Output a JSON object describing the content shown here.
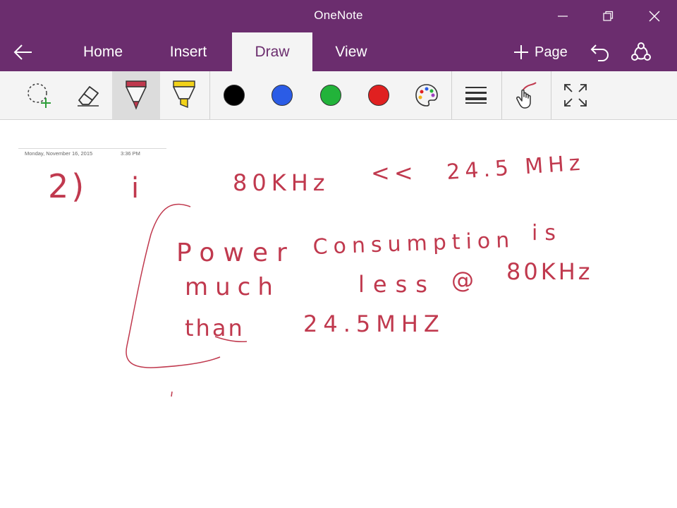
{
  "window": {
    "title": "OneNote",
    "controls": [
      "minimize",
      "restore",
      "close"
    ]
  },
  "ribbon": {
    "back_icon": "back-arrow-icon",
    "tabs": [
      {
        "label": "Home"
      },
      {
        "label": "Insert"
      },
      {
        "label": "Draw",
        "active": true
      },
      {
        "label": "View"
      }
    ],
    "add_page_label": "Page",
    "undo_icon": "undo-icon",
    "share_icon": "share-icon"
  },
  "toolbar": {
    "tools": [
      "lasso-select-icon",
      "eraser-icon",
      "pen-icon",
      "highlighter-icon"
    ],
    "selected_tool": "pen",
    "colors": [
      "#000000",
      "#2b5ce6",
      "#22b33a",
      "#e02020"
    ],
    "more_colors_icon": "color-palette-icon",
    "thickness_icon": "line-thickness-icon",
    "touch_draw_icon": "draw-with-touch-icon",
    "fullscreen_icon": "full-screen-icon"
  },
  "page": {
    "date": "Monday, November 16, 2015",
    "time": "3:36 PM",
    "ink_color": "#c0394e",
    "handwriting": {
      "number": "2)",
      "roman": "i",
      "line1_a": "80KHz",
      "line1_op": "<<",
      "line1_b": "24.5 MHz",
      "l2_w1": "Power",
      "l2_w2": "Consumption",
      "l2_w3": "is",
      "l3_w1": "much",
      "l3_w2": "less",
      "l3_w3": "@",
      "l3_w4": "80KHz",
      "l4_w1": "than",
      "l4_w2": "24.5MHZ"
    }
  }
}
